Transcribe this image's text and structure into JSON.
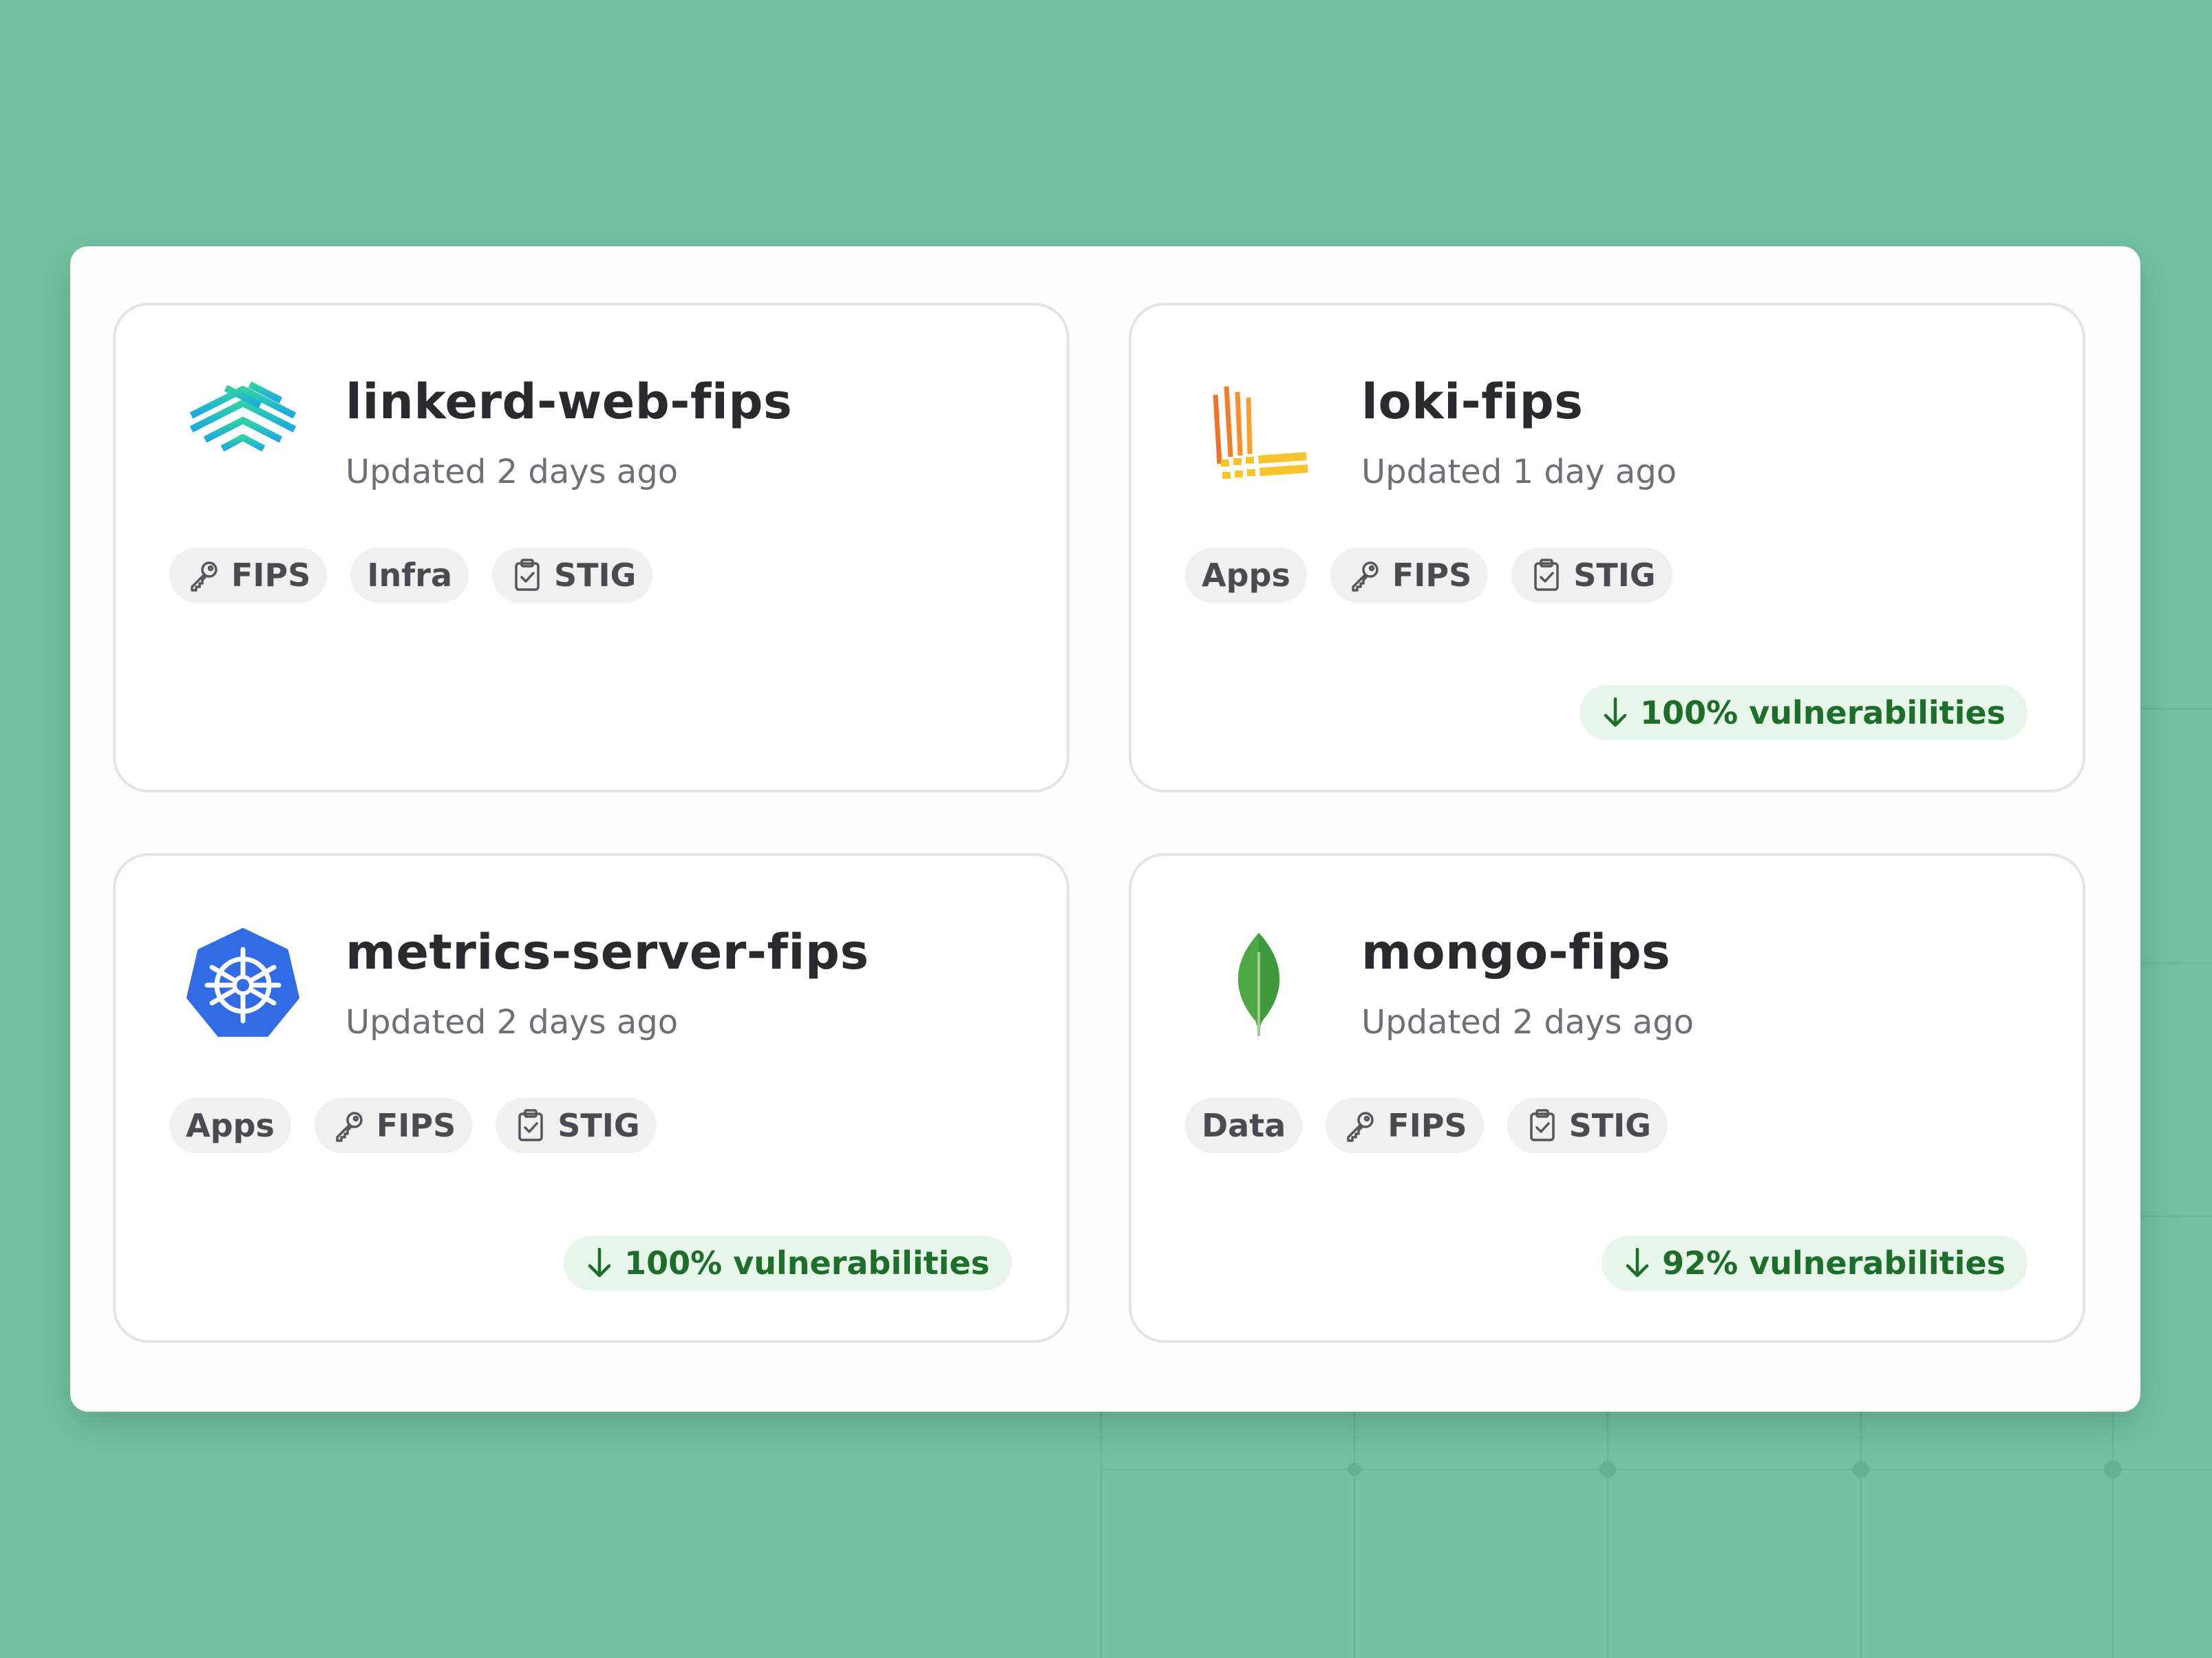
{
  "colors": {
    "background": "#73c3a2",
    "vuln_text": "#1d6d2b",
    "vuln_bg": "#e7f6e9"
  },
  "cards": [
    {
      "title": "linkerd-web-fips",
      "updated": "Updated 2 days ago",
      "logo": "linkerd-logo",
      "tags": [
        {
          "label": "FIPS",
          "icon": "key-icon"
        },
        {
          "label": "Infra",
          "icon": ""
        },
        {
          "label": "STIG",
          "icon": "clipboard-check-icon"
        }
      ],
      "vulnerabilities": ""
    },
    {
      "title": "loki-fips",
      "updated": "Updated 1 day ago",
      "logo": "loki-logo",
      "tags": [
        {
          "label": "Apps",
          "icon": ""
        },
        {
          "label": "FIPS",
          "icon": "key-icon"
        },
        {
          "label": "STIG",
          "icon": "clipboard-check-icon"
        }
      ],
      "vulnerabilities": "100% vulnerabilities"
    },
    {
      "title": "metrics-server-fips",
      "updated": "Updated 2 days ago",
      "logo": "kubernetes-logo",
      "tags": [
        {
          "label": "Apps",
          "icon": ""
        },
        {
          "label": "FIPS",
          "icon": "key-icon"
        },
        {
          "label": "STIG",
          "icon": "clipboard-check-icon"
        }
      ],
      "vulnerabilities": "100% vulnerabilities"
    },
    {
      "title": "mongo-fips",
      "updated": "Updated 2 days ago",
      "logo": "mongodb-leaf-logo",
      "tags": [
        {
          "label": "Data",
          "icon": ""
        },
        {
          "label": "FIPS",
          "icon": "key-icon"
        },
        {
          "label": "STIG",
          "icon": "clipboard-check-icon"
        }
      ],
      "vulnerabilities": "92% vulnerabilities"
    }
  ]
}
